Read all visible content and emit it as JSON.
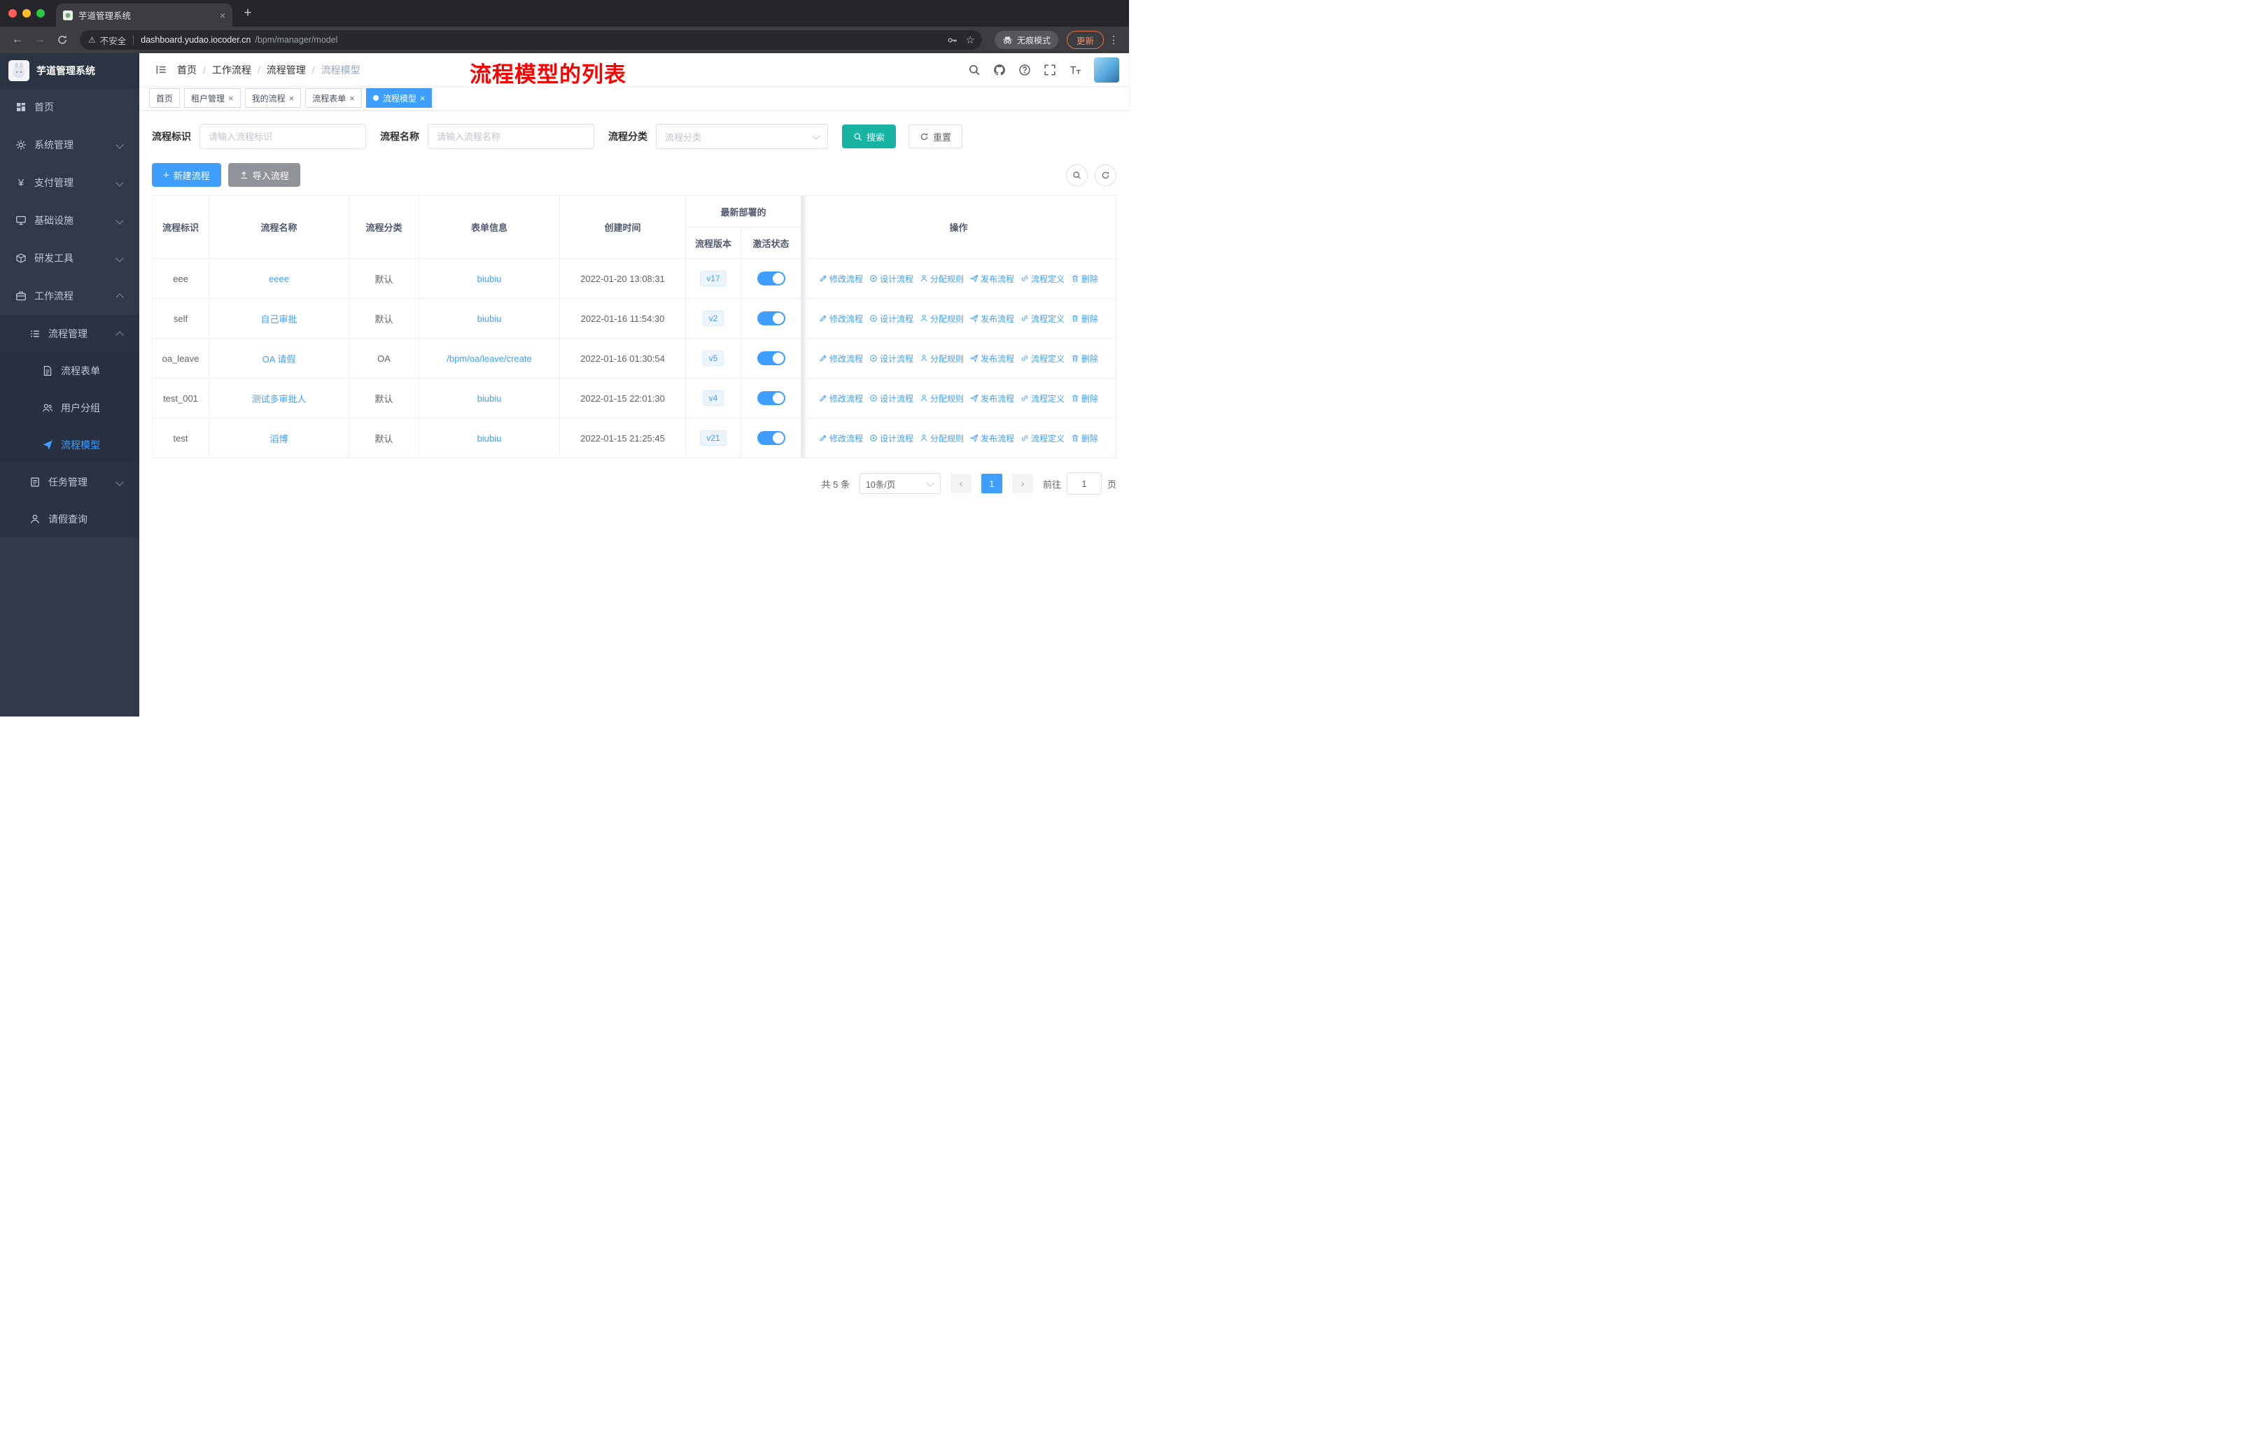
{
  "colors": {
    "primary_blue": "#409eff",
    "search_teal": "#17b3a3",
    "annotation_red": "#ff0000",
    "sidebar_bg": "#2f3949",
    "import_gray": "#909399",
    "version_badge_bg": "#ecf5ff",
    "traffic_red": "#ff5f57",
    "traffic_yellow": "#febc2e",
    "traffic_green": "#28c840"
  },
  "browser": {
    "tab_title": "芋道管理系统",
    "security_label": "不安全",
    "url_host": "dashboard.yudao.iocoder.cn",
    "url_path": "/bpm/manager/model",
    "incognito_label": "无痕模式",
    "update_label": "更新"
  },
  "sidebar": {
    "logo_title": "芋道管理系统",
    "items": {
      "home": "首页",
      "system": "系统管理",
      "payment": "支付管理",
      "infrastructure": "基础设施",
      "devtools": "研发工具",
      "workflow": "工作流程",
      "process_management": "流程管理",
      "process_form": "流程表单",
      "user_group": "用户分组",
      "process_model": "流程模型",
      "task_management": "任务管理",
      "leave_query": "请假查询"
    }
  },
  "header": {
    "breadcrumb": [
      "首页",
      "工作流程",
      "流程管理",
      "流程模型"
    ],
    "separator": "/",
    "annotation": "流程模型的列表"
  },
  "tags": [
    "首页",
    "租户管理",
    "我的流程",
    "流程表单",
    "流程模型"
  ],
  "filters": {
    "id_label": "流程标识",
    "id_placeholder": "请输入流程标识",
    "name_label": "流程名称",
    "name_placeholder": "请输入流程名称",
    "category_label": "流程分类",
    "category_placeholder": "流程分类",
    "search_label": "搜索",
    "reset_label": "重置"
  },
  "toolbar": {
    "create_label": "新建流程",
    "import_label": "导入流程"
  },
  "table": {
    "headers": {
      "id": "流程标识",
      "name": "流程名称",
      "category": "流程分类",
      "form": "表单信息",
      "created": "创建时间",
      "deployment_group": "最新部署的",
      "version": "流程版本",
      "active": "激活状态",
      "operations": "操作"
    },
    "actions": [
      "修改流程",
      "设计流程",
      "分配规则",
      "发布流程",
      "流程定义",
      "删除"
    ],
    "rows": [
      {
        "id": "eee",
        "name": "eeee",
        "category": "默认",
        "form": "biubiu",
        "created": "2022-01-20 13:08:31",
        "version": "v17",
        "active": true
      },
      {
        "id": "self",
        "name": "自己审批",
        "category": "默认",
        "form": "biubiu",
        "created": "2022-01-16 11:54:30",
        "version": "v2",
        "active": true
      },
      {
        "id": "oa_leave",
        "name": "OA 请假",
        "category": "OA",
        "form": "/bpm/oa/leave/create",
        "created": "2022-01-16 01:30:54",
        "version": "v5",
        "active": true
      },
      {
        "id": "test_001",
        "name": "测试多审批人",
        "category": "默认",
        "form": "biubiu",
        "created": "2022-01-15 22:01:30",
        "version": "v4",
        "active": true
      },
      {
        "id": "test",
        "name": "滔博",
        "category": "默认",
        "form": "biubiu",
        "created": "2022-01-15 21:25:45",
        "version": "v21",
        "active": true
      }
    ]
  },
  "pagination": {
    "total": "共 5 条",
    "page_size": "10条/页",
    "current_page": "1",
    "goto_label": "前往",
    "goto_value": "1",
    "page_unit": "页"
  },
  "icons": {
    "close_glyph": "×",
    "plus_glyph": "+",
    "newtab_glyph": "+",
    "back_glyph": "←",
    "forward_glyph": "→",
    "star_glyph": "☆",
    "warning_glyph": "⚠",
    "menu_dots_glyph": "⋮",
    "prev_glyph": "‹",
    "next_glyph": "›",
    "yen_glyph": "¥"
  }
}
